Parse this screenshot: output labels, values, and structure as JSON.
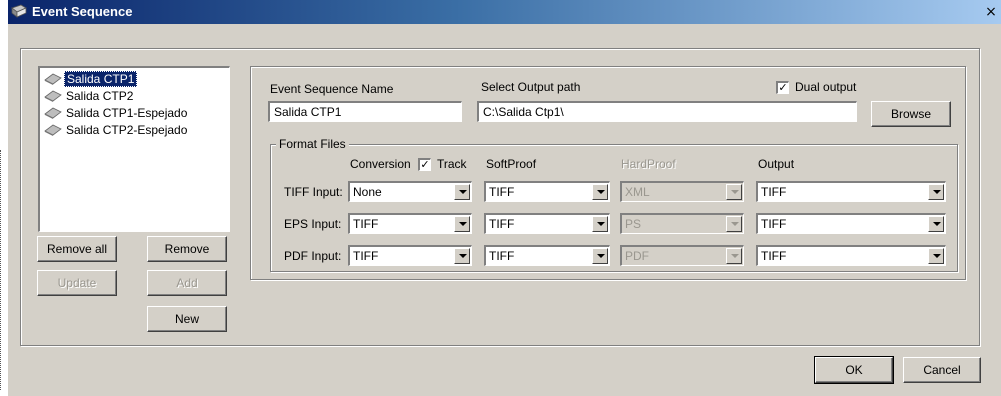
{
  "window": {
    "title": "Event Sequence",
    "close_glyph": "×"
  },
  "event_list": {
    "items": [
      {
        "label": "Salida CTP1",
        "selected": true
      },
      {
        "label": "Salida CTP2",
        "selected": false
      },
      {
        "label": "Salida CTP1-Espejado",
        "selected": false
      },
      {
        "label": "Salida CTP2-Espejado",
        "selected": false
      }
    ],
    "icon": "ctp-output-icon"
  },
  "list_buttons": {
    "remove_all": "Remove all",
    "remove": "Remove",
    "update": "Update",
    "add": "Add",
    "new": "New"
  },
  "form": {
    "name_label": "Event Sequence Name",
    "name_value": "Salida CTP1",
    "path_label": "Select Output path",
    "path_value": "C:\\Salida Ctp1\\",
    "dual_output_label": "Dual output",
    "dual_output_checked": true,
    "browse_label": "Browse"
  },
  "format_files": {
    "legend": "Format Files",
    "columns": {
      "conversion": "Conversion",
      "track": "Track",
      "track_checked": true,
      "softproof": "SoftProof",
      "hardproof": "HardProof",
      "output": "Output"
    },
    "rows": [
      {
        "label": "TIFF Input:",
        "conversion": "None",
        "softproof": "TIFF",
        "hardproof": "XML",
        "output": "TIFF"
      },
      {
        "label": "EPS Input:",
        "conversion": "TIFF",
        "softproof": "TIFF",
        "hardproof": "PS",
        "output": "TIFF"
      },
      {
        "label": "PDF Input:",
        "conversion": "TIFF",
        "softproof": "TIFF",
        "hardproof": "PDF",
        "output": "TIFF"
      }
    ]
  },
  "dialog_buttons": {
    "ok": "OK",
    "cancel": "Cancel"
  },
  "colors": {
    "face": "#d4d0c8",
    "titlebar_start": "#0a246a",
    "titlebar_end": "#a6caf0",
    "selection": "#0a246a"
  }
}
